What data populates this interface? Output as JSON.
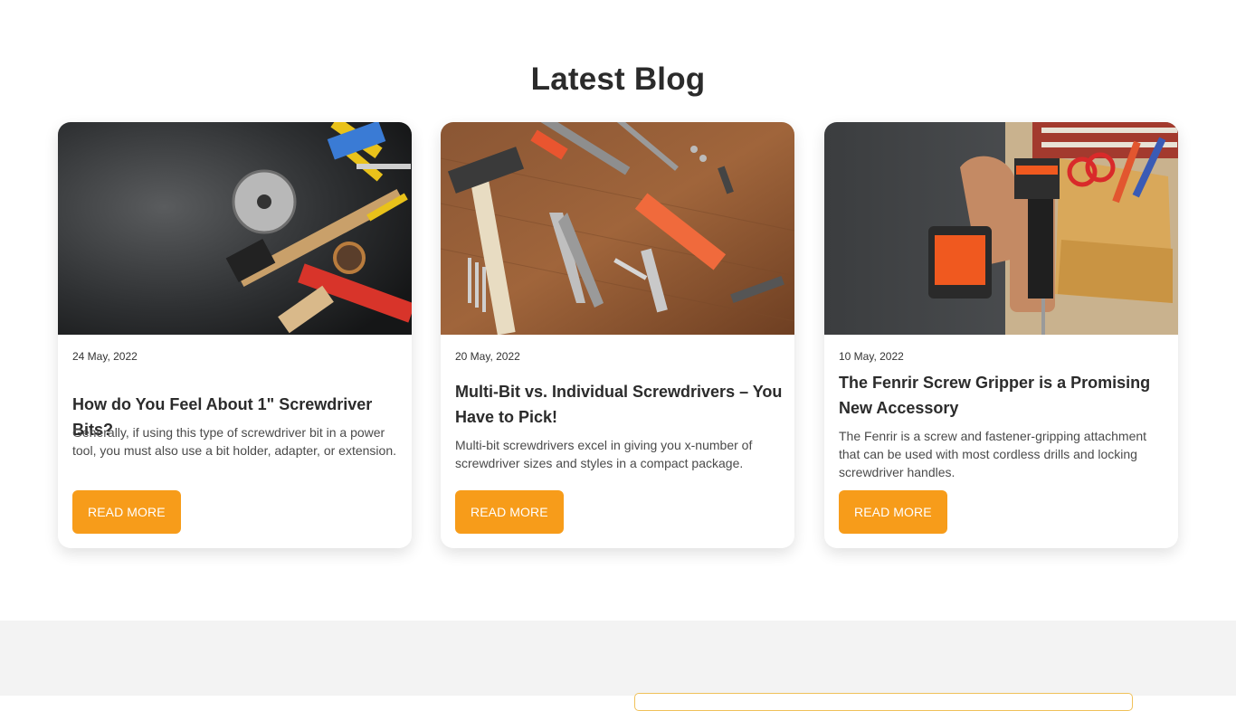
{
  "section": {
    "title": "Latest Blog"
  },
  "posts": [
    {
      "date": "24 May, 2022",
      "title": "How do You Feel About 1\" Screwdriver Bits?",
      "excerpt": "Generally, if using this type of screwdriver bit in a power tool, you must also use a bit holder, adapter, or extension.",
      "button": "READ MORE",
      "image": "tools-on-dark-stone-image"
    },
    {
      "date": "20 May, 2022",
      "title": "Multi-Bit vs. Individual Screwdrivers – You Have to Pick!",
      "excerpt": "Multi-bit screwdrivers excel in giving you x-number of screwdriver sizes and styles in a compact package.",
      "button": "READ MORE",
      "image": "tools-on-wood-table-image"
    },
    {
      "date": "10 May, 2022",
      "title": "The Fenrir Screw Gripper is a Promising New Accessory",
      "excerpt": "The Fenrir is a screw and fastener-gripping attachment that can be used with most cordless drills and locking screwdriver handles.",
      "button": "READ MORE",
      "image": "worker-with-cordless-drill-image"
    }
  ],
  "colors": {
    "accent": "#f79c1a",
    "heading": "#2b2b2b",
    "footer_bg": "#f3f3f3"
  }
}
